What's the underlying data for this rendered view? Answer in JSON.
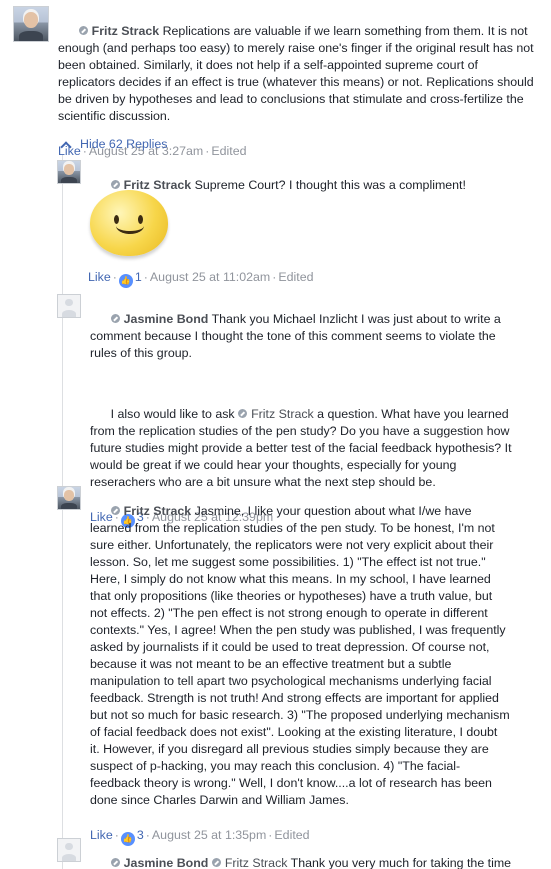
{
  "top_comment": {
    "author": "Fritz Strack",
    "text": "Replications are valuable if we learn something from them. It is not enough (and perhaps too easy) to merely raise one's finger if the original result has not been obtained. Similarly, it does not help if a self-appointed supreme court of replicators decides if an effect is true (whatever this means) or not. Replications should be driven by hypotheses and lead to conclusions that stimulate and cross-fertilize the scientific discussion.",
    "like_label": "Like",
    "time": "August 25 at 3:27am",
    "edited": "Edited"
  },
  "replies_toggle": "Hide 62 Replies",
  "replies": [
    {
      "author": "Fritz Strack",
      "text": "Supreme Court? I thought this was a compliment!",
      "sticker": "smiley-sticker",
      "like_label": "Like",
      "reaction_count": "1",
      "time": "August 25 at 11:02am",
      "edited": "Edited"
    },
    {
      "author": "Jasmine Bond",
      "text": "Thank you Michael Inzlicht I was just about to write a comment because I thought the tone of this comment seems to violate the rules of this group.",
      "text2_before": "I also would like to ask ",
      "mention": "Fritz Strack",
      "text2_after": " a question. What have you learned from the replication studies of the pen study? Do you have a suggestion how future studies might provide a better test of the facial feedback hypothesis? It would be great if we could hear your thoughts, especially for young reserachers who are a bit unsure what the next step should be.",
      "like_label": "Like",
      "reaction_count": "3",
      "time": "August 25 at 12:39pm"
    },
    {
      "author": "Fritz Strack",
      "text": "Jasmine, I like your question about what I/we have learned from the replication studies of the pen study. To be honest, I'm not sure either. Unfortunately, the replicators were not very explicit about their lesson. So, let me suggest some possibilities. 1) \"The effect ist not true.\" Here, I simply do not know what this means. In my school, I have learned that only propositions (like theories or hypotheses) have a truth value, but not effects. 2) \"The pen effect is not strong enough to operate in different contexts.\" Yes, I agree! When the pen study was published, I was frequently asked by journalists if it could be used to treat depression. Of course not, because it was not meant to be an effective treatment but a subtle manipulation to tell apart two psychological mechanisms underlying facial feedback. Strength is not truth! And strong effects are important for applied but not so much for basic research. 3) \"The proposed underlying mechanism of facial feedback does not exist\". Looking at the existing literature, I doubt it. However, if you disregard all previous studies simply because they are suspect of p-hacking, you may reach this conclusion. 4) \"The facial-feedback theory is wrong.\" Well, I don't know....a lot of research has been done since Charles Darwin and William James.",
      "like_label": "Like",
      "reaction_count": "3",
      "time": "August 25 at 1:35pm",
      "edited": "Edited"
    },
    {
      "author": "Jasmine Bond",
      "mention": "Fritz Strack",
      "text": " Thank you very much for taking the time to answer my question. I feel very honored."
    }
  ],
  "colors": {
    "link": "#4267b2",
    "meta": "#90949c",
    "author": "#4b4f56",
    "reaction": "#5890ff"
  }
}
